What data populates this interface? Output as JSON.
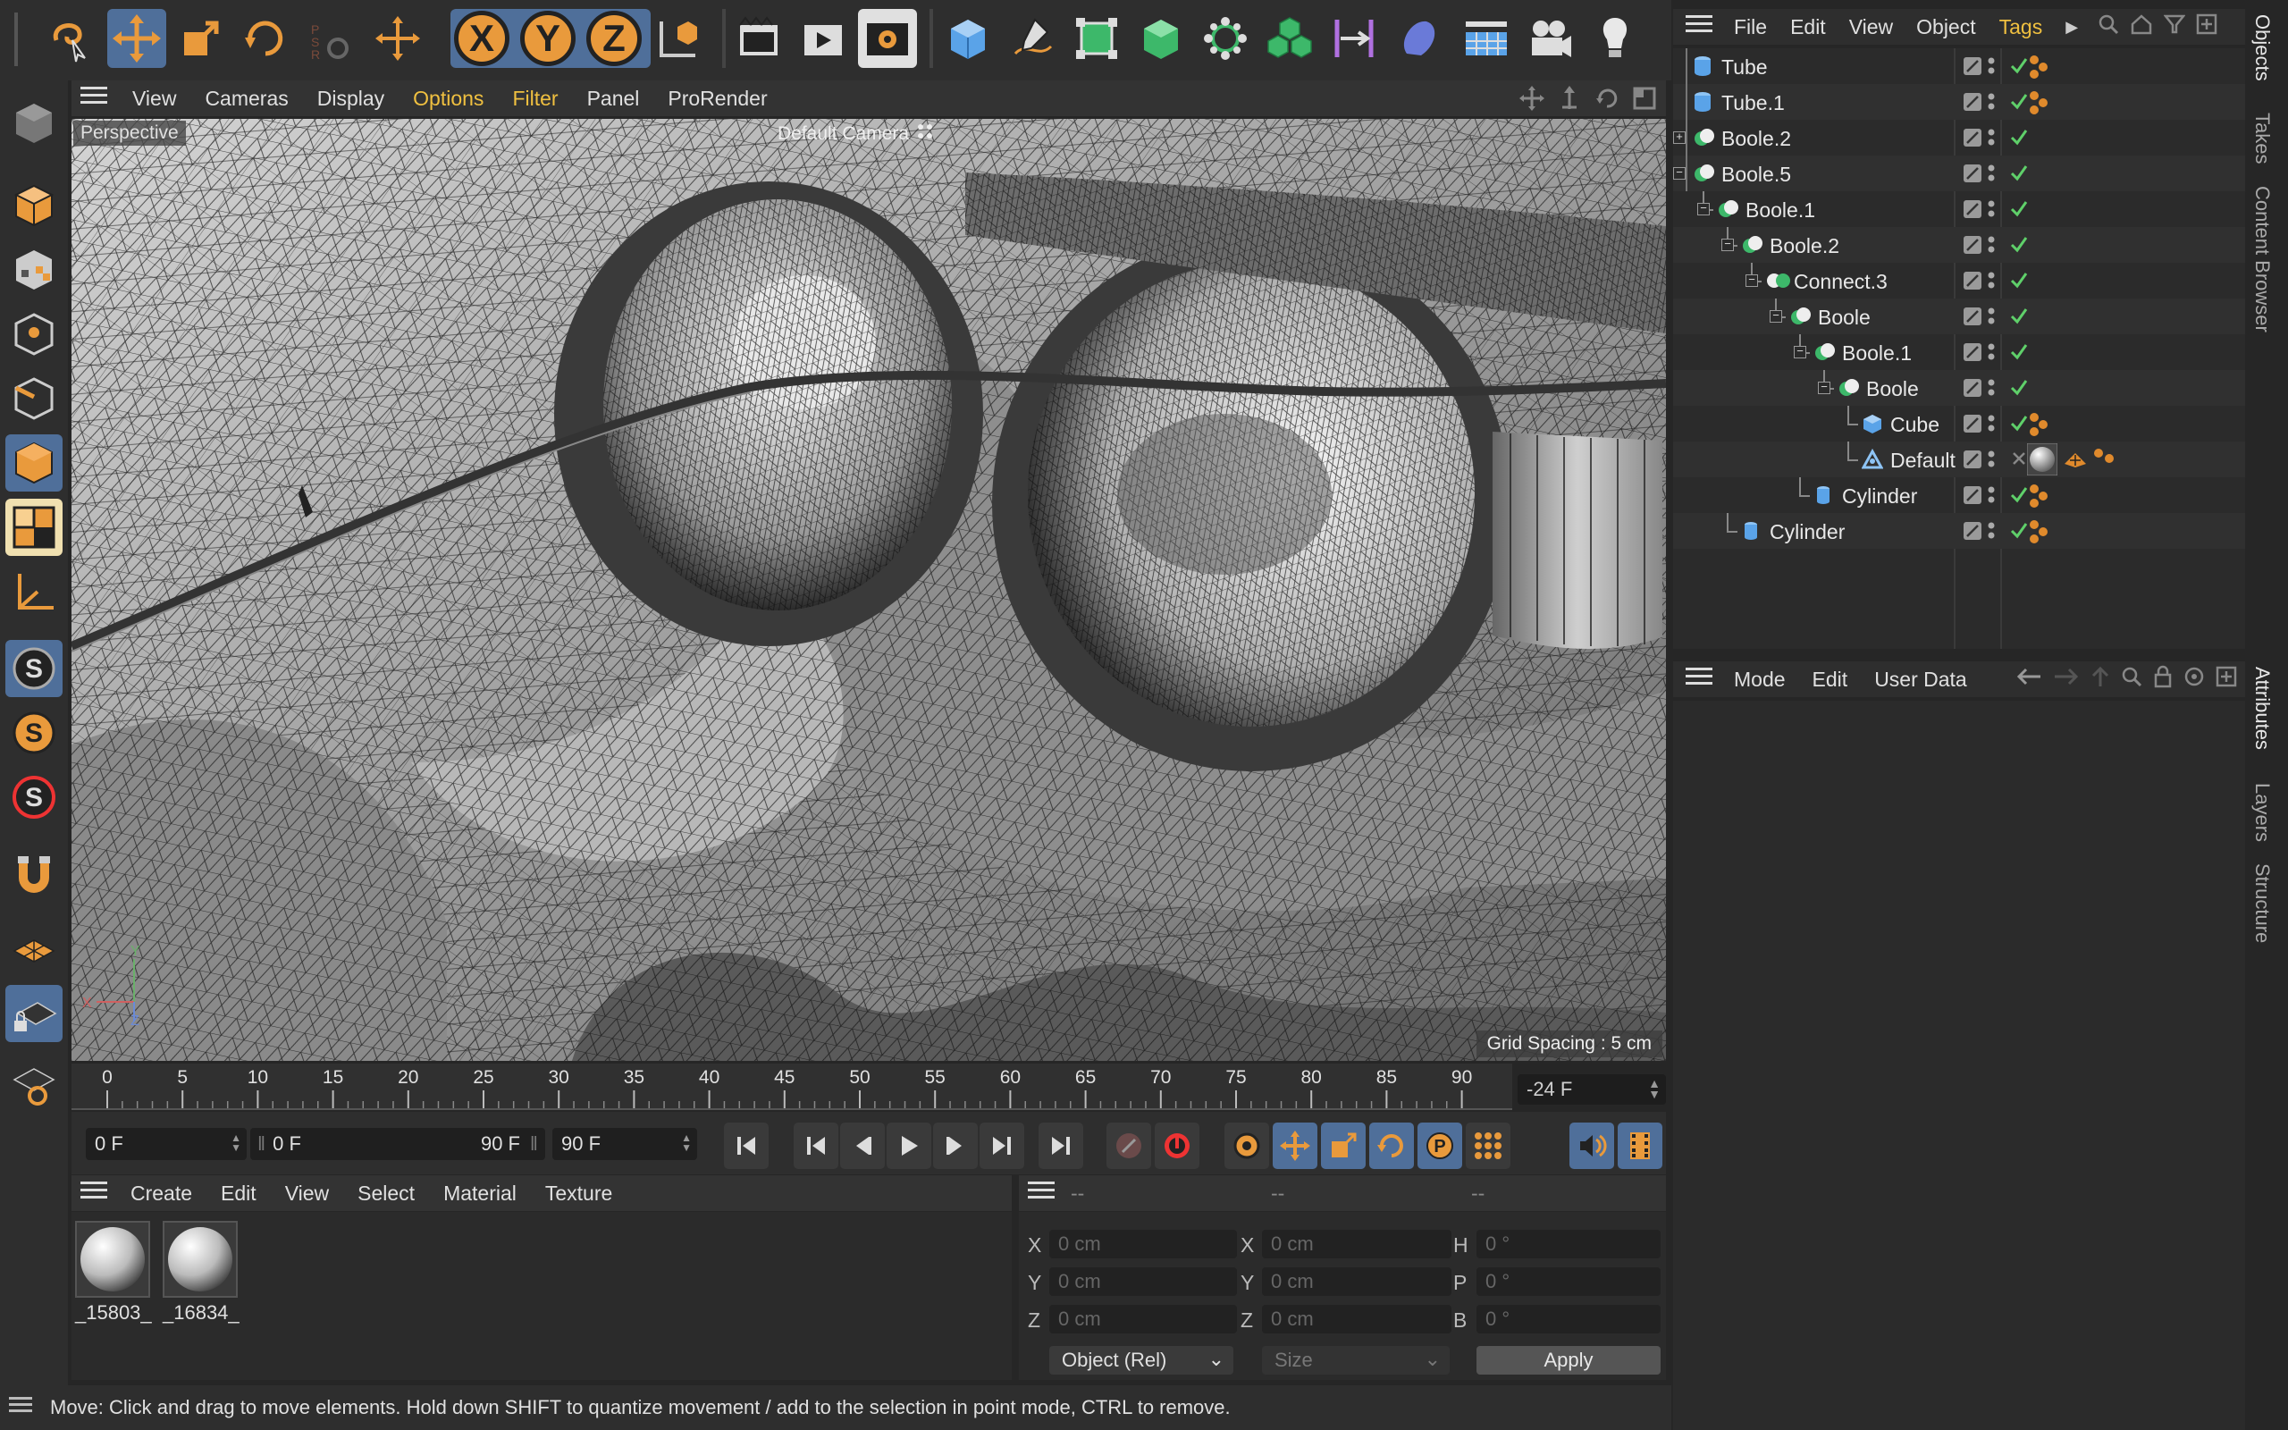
{
  "viewport": {
    "menu": [
      "View",
      "Cameras",
      "Display",
      "Options",
      "Filter",
      "Panel",
      "ProRender"
    ],
    "label": "Perspective",
    "camera": "Default Camera",
    "grid_spacing": "Grid Spacing : 5 cm"
  },
  "timeline": {
    "ticks": [
      "0",
      "5",
      "10",
      "15",
      "20",
      "25",
      "30",
      "35",
      "40",
      "45",
      "50",
      "55",
      "60",
      "65",
      "70",
      "75",
      "80",
      "85",
      "90"
    ],
    "current_frame_box": "-24 F",
    "start_field": "0 F",
    "range_start": "0 F",
    "range_end": "90 F",
    "end_field": "90 F"
  },
  "material_manager": {
    "menu": [
      "Create",
      "Edit",
      "View",
      "Select",
      "Material",
      "Texture"
    ],
    "materials": [
      "_15803_",
      "_16834_"
    ]
  },
  "coordinates": {
    "headers": [
      "--",
      "--",
      "--"
    ],
    "rows": [
      {
        "l1": "X",
        "v1": "0 cm",
        "l2": "X",
        "v2": "0 cm",
        "l3": "H",
        "v3": "0 °"
      },
      {
        "l1": "Y",
        "v1": "0 cm",
        "l2": "Y",
        "v2": "0 cm",
        "l3": "P",
        "v3": "0 °"
      },
      {
        "l1": "Z",
        "v1": "0 cm",
        "l2": "Z",
        "v2": "0 cm",
        "l3": "B",
        "v3": "0 °"
      }
    ],
    "mode_select": "Object (Rel)",
    "size_select": "Size",
    "apply": "Apply"
  },
  "status_text": "Move: Click and drag to move elements. Hold down SHIFT to quantize movement / add to the selection in point mode, CTRL to remove.",
  "objects_panel": {
    "menu": [
      "File",
      "Edit",
      "View",
      "Object",
      "Tags"
    ],
    "items": [
      {
        "name": "Tube",
        "depth": 0,
        "icon": "tube",
        "tag": "dots"
      },
      {
        "name": "Tube.1",
        "depth": 0,
        "icon": "tube",
        "tag": "dots"
      },
      {
        "name": "Boole.2",
        "depth": 0,
        "icon": "boole",
        "expand": "+"
      },
      {
        "name": "Boole.5",
        "depth": 0,
        "icon": "boole",
        "expand": "-"
      },
      {
        "name": "Boole.1",
        "depth": 1,
        "icon": "boole",
        "expand": "-"
      },
      {
        "name": "Boole.2",
        "depth": 2,
        "icon": "boole",
        "expand": "-"
      },
      {
        "name": "Connect.3",
        "depth": 3,
        "icon": "connect",
        "expand": "-"
      },
      {
        "name": "Boole",
        "depth": 4,
        "icon": "boole",
        "expand": "-"
      },
      {
        "name": "Boole.1",
        "depth": 5,
        "icon": "boole",
        "expand": "-"
      },
      {
        "name": "Boole",
        "depth": 6,
        "icon": "boole",
        "expand": "-"
      },
      {
        "name": "Cube",
        "depth": 7,
        "icon": "cube",
        "tag": "dots"
      },
      {
        "name": "Default",
        "depth": 7,
        "icon": "sculpt",
        "tag": "material"
      },
      {
        "name": "Cylinder",
        "depth": 5,
        "icon": "cylinder",
        "tag": "dots"
      },
      {
        "name": "Cylinder",
        "depth": 2,
        "icon": "cylinder",
        "tag": "dots"
      }
    ]
  },
  "attributes_panel": {
    "menu": [
      "Mode",
      "Edit",
      "User Data"
    ]
  },
  "side_tabs": {
    "top": [
      "Objects",
      "Takes",
      "Content Browser"
    ],
    "bottom": [
      "Attributes",
      "Layers",
      "Structure"
    ]
  },
  "colors": {
    "accent_orange": "#e99a3c",
    "selected_blue": "#4f6f9a",
    "check_green": "#5fd06a"
  }
}
